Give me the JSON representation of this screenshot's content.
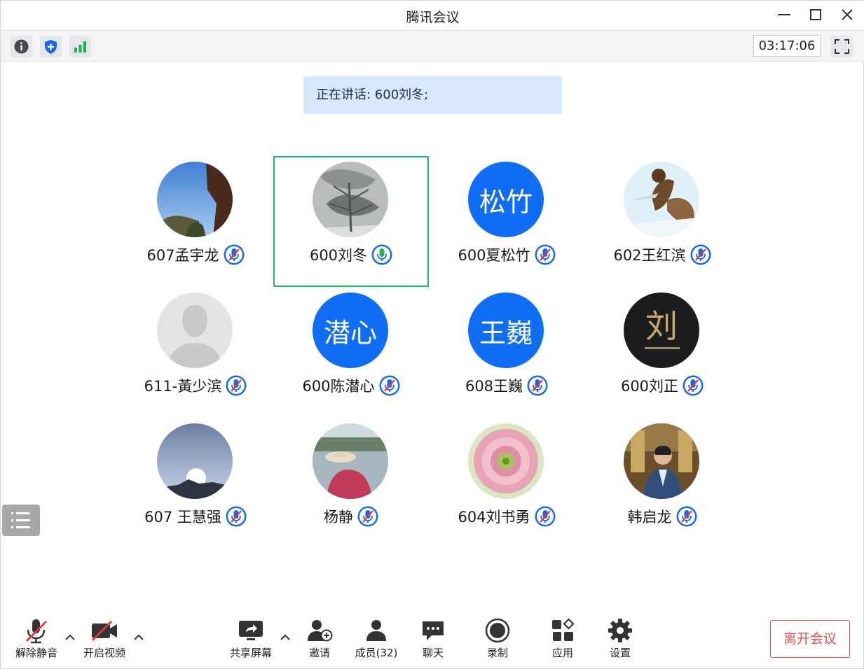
{
  "window": {
    "title": "腾讯会议"
  },
  "topbar": {
    "timer": "03:17:06",
    "icons": [
      "info-icon",
      "shield-icon",
      "signal-icon",
      "fullscreen-icon"
    ]
  },
  "banner": {
    "speaking": "正在讲话: 600刘冬;"
  },
  "participants": [
    {
      "name": "607孟宇龙",
      "avatar": "photo-sky-tree",
      "mic": "muted"
    },
    {
      "name": "600刘冬",
      "avatar": "photo-snow-tree",
      "mic": "active",
      "speaking": true
    },
    {
      "name": "600夏松竹",
      "avatar_text": "松竹",
      "mic": "muted"
    },
    {
      "name": "602王红滨",
      "avatar": "photo-squirrel",
      "mic": "muted"
    },
    {
      "name": "611-黃少滨",
      "avatar": "default-person",
      "mic": "muted"
    },
    {
      "name": "600陈潜心",
      "avatar_text": "潜心",
      "mic": "muted"
    },
    {
      "name": "608王巍",
      "avatar_text": "王巍",
      "mic": "muted"
    },
    {
      "name": "600刘正",
      "avatar": "photo-calligraphy",
      "mic": "muted"
    },
    {
      "name": "607 王慧强",
      "avatar": "photo-temple-sky",
      "mic": "muted"
    },
    {
      "name": "杨静",
      "avatar": "photo-lake-hat",
      "mic": "muted"
    },
    {
      "name": "604刘书勇",
      "avatar": "photo-flower",
      "mic": "muted"
    },
    {
      "name": "韩启龙",
      "avatar": "photo-man-suit",
      "mic": "muted"
    }
  ],
  "controls": {
    "unmute": "解除静音",
    "video": "开启视频",
    "share": "共享屏幕",
    "invite": "邀请",
    "members": "成员(32)",
    "chat": "聊天",
    "record": "录制",
    "apps": "应用",
    "settings": "设置",
    "leave": "离开会议"
  },
  "colors": {
    "accent": "#0f6ef5",
    "speaking_border": "#1fb86a",
    "banner_bg": "#d8e8fd",
    "leave": "#e8504c",
    "mute_slash": "#e53935"
  }
}
